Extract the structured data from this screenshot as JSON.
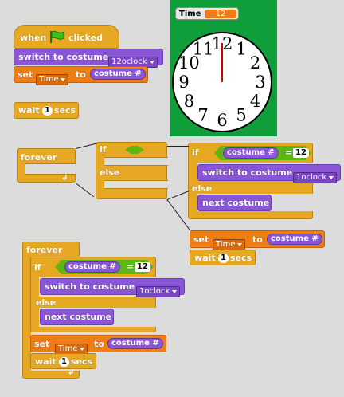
{
  "script1": {
    "hat_when": "when",
    "hat_clicked": "clicked",
    "switch_label": "switch to costume",
    "costume_value": "12oclock",
    "set_label": "set",
    "set_var": "Time",
    "to_label": "to",
    "costume_reporter": "costume #",
    "wait_label": "wait",
    "wait_value": "1",
    "secs_label": "secs"
  },
  "stage": {
    "monitor_name": "Time",
    "monitor_value": "12",
    "clock_numbers": [
      "12",
      "1",
      "2",
      "3",
      "4",
      "5",
      "6",
      "7",
      "8",
      "9",
      "10",
      "11"
    ]
  },
  "script2": {
    "forever_label": "forever",
    "if_label": "if",
    "else_label": "else",
    "if2_label": "if",
    "costume_reporter": "costume #",
    "eq": "=",
    "eq_value": "12",
    "switch_label": "switch to costume",
    "costume_value": "1oclock",
    "else2_label": "else",
    "next_costume": "next costume",
    "set_label": "set",
    "set_var": "Time",
    "to_label": "to",
    "costume_reporter2": "costume #",
    "wait_label": "wait",
    "wait_value": "1",
    "secs_label": "secs"
  },
  "script3": {
    "forever_label": "forever",
    "if_label": "if",
    "costume_reporter": "costume #",
    "eq": "=",
    "eq_value": "12",
    "switch_label": "switch to costume",
    "costume_value": "1oclock",
    "else_label": "else",
    "next_costume": "next costume",
    "set_label": "set",
    "set_var": "Time",
    "to_label": "to",
    "costume_reporter2": "costume #",
    "wait_label": "wait",
    "wait_value": "1",
    "secs_label": "secs"
  },
  "colors": {
    "control": "#e6a822",
    "looks": "#8a55d7",
    "variables": "#ee7d16",
    "operators": "#5cb712",
    "stage_bg": "#0f9e3a",
    "workspace": "#dcdcdc"
  },
  "icons": [
    "green-flag-icon",
    "return-arrow-icon",
    "dropdown-arrow-icon"
  ]
}
